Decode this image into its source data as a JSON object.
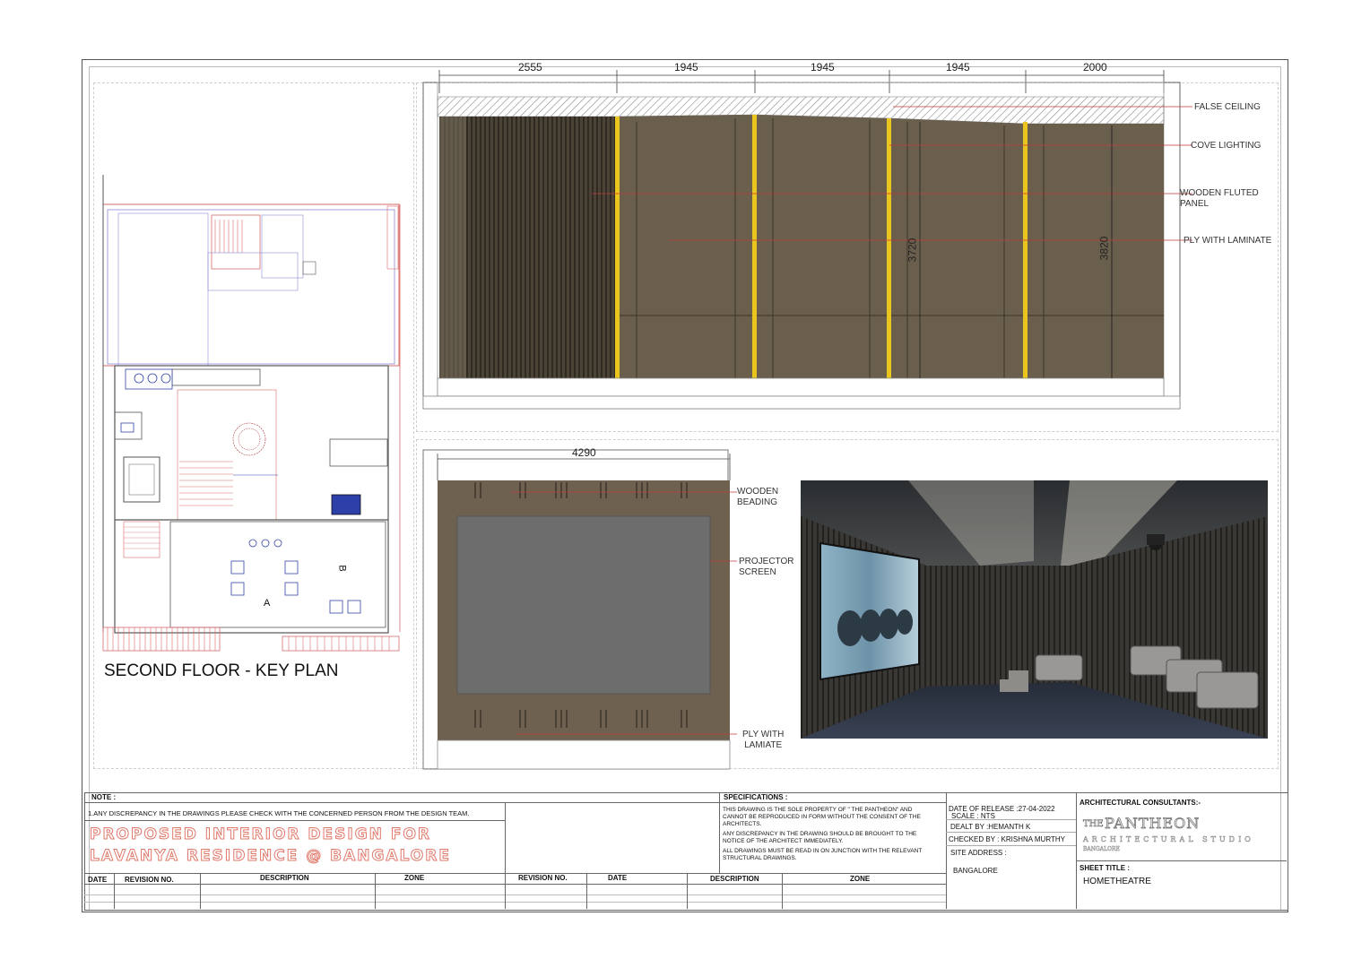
{
  "keyplan": {
    "title": "SECOND FLOOR - KEY PLAN",
    "markers": [
      "A",
      "B"
    ]
  },
  "elevation_main": {
    "dimensions": [
      "2555",
      "1945",
      "1945",
      "1945",
      "2000"
    ],
    "heights": [
      "3720",
      "3820"
    ],
    "callouts": [
      {
        "text": "FALSE CEILING"
      },
      {
        "text": "COVE LIGHTING"
      },
      {
        "text": "WOODEN FLUTED\nPANEL"
      },
      {
        "text": "PLY WITH LAMINATE"
      }
    ]
  },
  "elevation_screen": {
    "dimension": "4290",
    "callouts": [
      {
        "text": "WOODEN\nBEADING"
      },
      {
        "text": "PROJECTOR\nSCREEN"
      },
      {
        "text": "PLY WITH\nLAMIATE"
      }
    ]
  },
  "titleblock": {
    "note_label": "NOTE :",
    "note_text": "1.ANY DISCREPANCY IN THE DRAWINGS PLEASE CHECK WITH THE CONCERNED PERSON FROM THE DESIGN TEAM.",
    "project_line1": "PROPOSED INTERIOR DESIGN  FOR",
    "project_line2": "LAVANYA RESIDENCE @ BANGALORE",
    "spec_label": "SPECIFICATIONS :",
    "spec_1": "THIS DRAWING IS THE SOLE PROPERTY OF \" THE PANTHEON\" AND CANNOT BE REPRODUCED IN FORM WITHOUT THE CONSENT OF THE ARCHITECTS.",
    "spec_2": "ANY DISCREPANCY IN THE DRAWING SHOULD BE BROUGHT TO THE NOTICE OF THE  ARCHITECT IMMEDIATELY.",
    "spec_3": "ALL DRAWINGS MUST BE READ IN ON JUNCTION WITH THE RELEVANT STRUCTURAL DRAWINGS.",
    "release": "DATE OF RELEASE :27-04-2022",
    "scale": "SCALE : NTS",
    "dealt": "DEALT BY :HEMANTH K",
    "checked": "CHECKED BY : KRISHNA MURTHY",
    "site_label": "SITE ADDRESS :",
    "site": "BANGALORE",
    "consultants_label": "ARCHITECTURAL CONSULTANTS:-",
    "brand_the": "THE",
    "brand_name": "PANTHEON",
    "brand_sub": "ARCHITECTURAL STUDIO",
    "brand_city": "BANGALORE",
    "sheet_label": "SHEET TITLE :",
    "sheet": "HOMETHEATRE",
    "rev_headers_left": [
      "DATE",
      "REVISION NO.",
      "DESCRIPTION",
      "ZONE"
    ],
    "rev_headers_right": [
      "REVISION NO.",
      "DATE",
      "DESCRIPTION",
      "ZONE"
    ]
  }
}
